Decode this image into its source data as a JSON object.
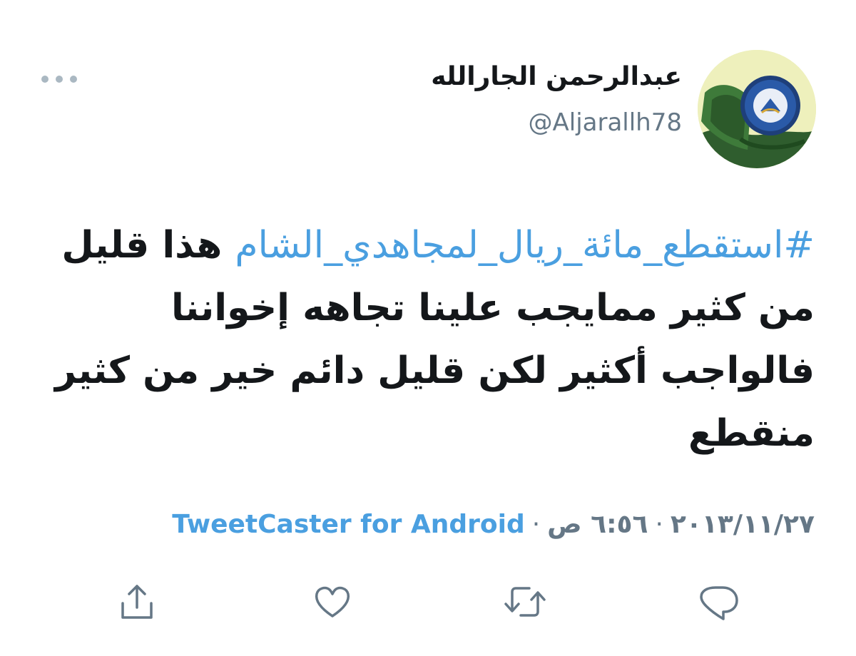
{
  "tweet": {
    "author": {
      "display_name": "عبدالرحمن الجارالله",
      "handle": "@Aljarallh78",
      "avatar_icon": "avatar-image"
    },
    "more_icon": "more-icon",
    "text": {
      "hashtag": "#استقطع_مائة_ريال_لمجاهدي_الشام",
      "body": " هذا قليل من كثير ممايجب علينا تجاهه إخواننا فالواجب أكثير لكن قليل دائم خير من كثير منقطع"
    },
    "meta": {
      "date": "٢٠١٣/١١/٢٧",
      "separator": "·",
      "time": "٦:٥٦ ص",
      "source": "TweetCaster for Android"
    },
    "actions": {
      "reply_icon": "reply-icon",
      "retweet_icon": "retweet-icon",
      "like_icon": "heart-icon",
      "share_icon": "share-icon"
    },
    "colors": {
      "link": "#4a9fe0",
      "secondary_text": "#657786",
      "primary_text": "#14171a",
      "icon": "#657786",
      "avatar_green": "#2f5d2e"
    }
  }
}
